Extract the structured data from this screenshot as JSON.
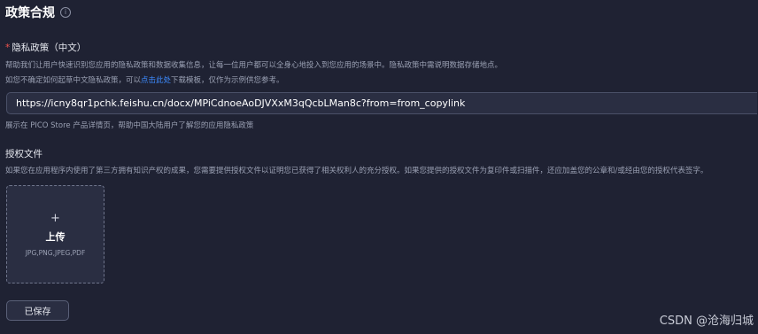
{
  "section": {
    "title": "政策合规",
    "info_icon": "i"
  },
  "privacy": {
    "required_mark": "*",
    "label": "隐私政策（中文）",
    "help_line1": "帮助我们让用户快速识别您应用的隐私政策和数据收集信息，让每一位用户都可以全身心地投入到您应用的场景中。隐私政策中需说明数据存储地点。",
    "help_line2_prefix": "如您不确定如何起草中文隐私政策，可以",
    "help_line2_link": "点击此处",
    "help_line2_suffix": "下载模板，仅作为示例供您参考。",
    "url_value": "https://icny8qr1pchk.feishu.cn/docx/MPiCdnoeAoDJVXxM3qQcbLMan8c?from=from_copylink",
    "below_hint": "展示在 PICO Store 产品详情页，帮助中国大陆用户了解您的应用隐私政策"
  },
  "authorization": {
    "label": "授权文件",
    "help": "如果您在应用程序内使用了第三方拥有知识产权的成果，您需要提供授权文件以证明您已获得了相关权利人的充分授权。如果您提供的授权文件为复印件或扫描件，还应加盖您的公章和/或经由您的授权代表签字。",
    "upload": {
      "icon": "plus-icon",
      "plus": "+",
      "label": "上传",
      "formats": "JPG,PNG,JPEG,PDF"
    }
  },
  "footer": {
    "save_label": "已保存",
    "watermark": "CSDN @沧海归城"
  }
}
